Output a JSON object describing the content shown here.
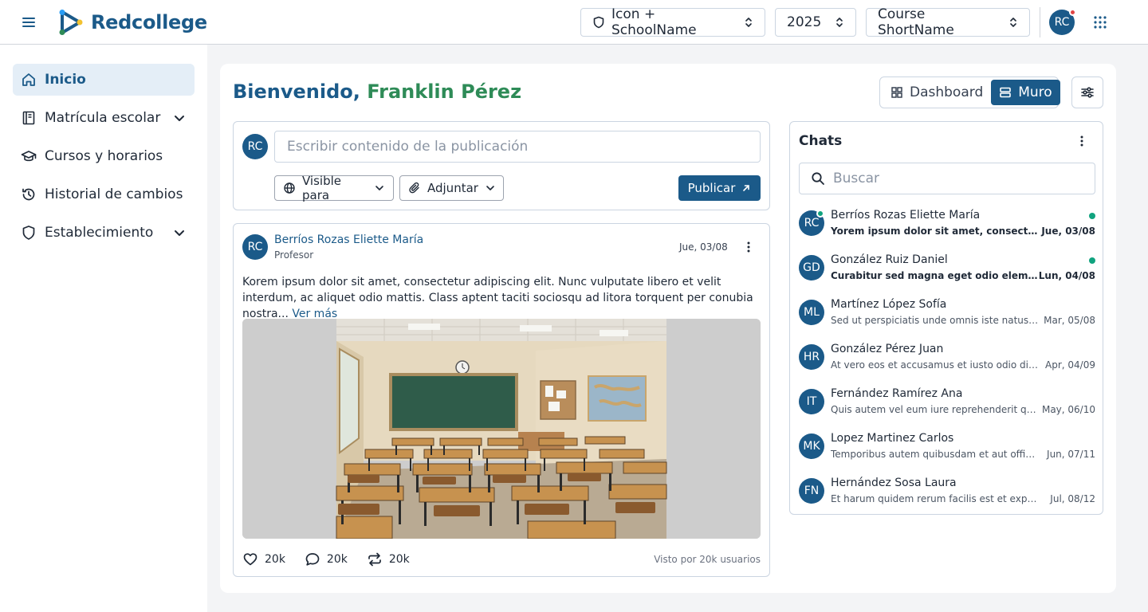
{
  "brand": {
    "name": "Redcollege"
  },
  "header": {
    "school_selector": "Icon + SchoolName",
    "year_selector": "2025",
    "course_selector": "Course ShortName",
    "user_initials": "RC"
  },
  "sidebar": {
    "items": [
      {
        "label": "Inicio",
        "icon": "home-icon",
        "active": true
      },
      {
        "label": "Matrícula escolar",
        "icon": "book-icon",
        "expandable": true
      },
      {
        "label": "Cursos y horarios",
        "icon": "graduation-cap-icon"
      },
      {
        "label": "Historial de cambios",
        "icon": "history-icon"
      },
      {
        "label": "Establecimiento",
        "icon": "shield-icon",
        "expandable": true
      }
    ]
  },
  "main": {
    "welcome_prefix": "Bienvenido,",
    "welcome_name": "Franklin Pérez",
    "views": {
      "dashboard": "Dashboard",
      "muro": "Muro",
      "active": "Muro"
    }
  },
  "composer": {
    "initials": "RC",
    "placeholder": "Escribir contenido de la publicación",
    "visible_label": "Visible para",
    "attach_label": "Adjuntar",
    "publish_label": "Publicar"
  },
  "post": {
    "initials": "RC",
    "author": "Berríos Rozas Eliette María",
    "role": "Profesor",
    "date": "Jue, 03/08",
    "body": "Korem ipsum dolor sit amet, consectetur adipiscing elit. Nunc vulputate libero et velit interdum, ac aliquet odio mattis. Class aptent taciti sociosqu ad litora torquent per conubia nostra...",
    "more": "Ver más",
    "likes": "20k",
    "comments": "20k",
    "shares": "20k",
    "views": "Visto por 20k usuarios"
  },
  "chats": {
    "title": "Chats",
    "search_placeholder": "Buscar",
    "items": [
      {
        "initials": "RC",
        "name": "Berríos Rozas Eliette María",
        "message": "Yorem ipsum dolor sit amet, consectetur adipiscing elit.",
        "date": "Jue, 03/08",
        "unread": true,
        "online": true
      },
      {
        "initials": "GD",
        "name": "González Ruiz Daniel",
        "message": "Curabitur sed magna eget odio elementum aliquet.",
        "date": "Lun, 04/08",
        "unread": true,
        "online": false
      },
      {
        "initials": "ML",
        "name": "Martínez López Sofía",
        "message": "Sed ut perspiciatis unde omnis iste natus error sit.",
        "date": "Mar, 05/08",
        "unread": false,
        "online": false
      },
      {
        "initials": "HR",
        "name": "González Pérez Juan",
        "message": "At vero eos et accusamus et iusto odio dignissimos.",
        "date": "Apr, 04/09",
        "unread": false,
        "online": false
      },
      {
        "initials": "IT",
        "name": "Fernández Ramírez Ana",
        "message": "Quis autem vel eum iure reprehenderit qui in ea.",
        "date": "May, 06/10",
        "unread": false,
        "online": false
      },
      {
        "initials": "MK",
        "name": "Lopez Martinez Carlos",
        "message": "Temporibus autem quibusdam et aut officiis debitis.",
        "date": "Jun, 07/11",
        "unread": false,
        "online": false
      },
      {
        "initials": "FN",
        "name": "Hernández Sosa Laura",
        "message": "Et harum quidem rerum facilis est et expedita distinctio.",
        "date": "Jul, 08/12",
        "unread": false,
        "online": false
      }
    ]
  },
  "colors": {
    "primary": "#1b5a89",
    "accent_green": "#2e8b57",
    "online": "#10a37f",
    "notification": "#e04545"
  }
}
